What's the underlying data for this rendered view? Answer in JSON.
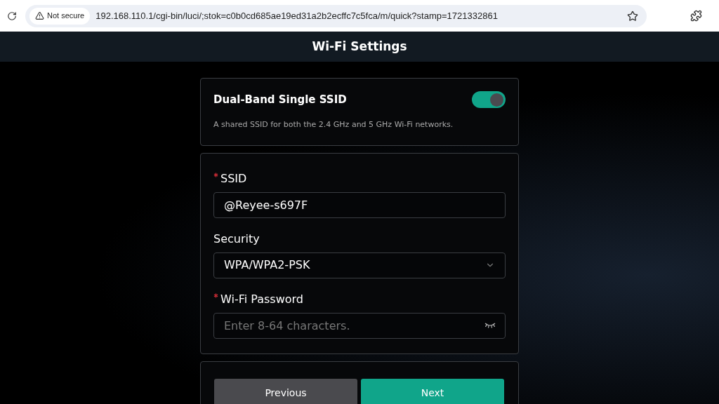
{
  "browser": {
    "security_label": "Not secure",
    "url": "192.168.110.1/cgi-bin/luci/;stok=c0b0cd685ae19ed31a2b2ecffc7c5fca/m/quick?stamp=1721332861"
  },
  "header": {
    "title": "Wi-Fi Settings"
  },
  "dual_band": {
    "title": "Dual-Band Single SSID",
    "description": "A shared SSID for both the 2.4 GHz and 5 GHz Wi-Fi networks.",
    "on": true
  },
  "form": {
    "fields": [
      {
        "kind": "text",
        "label": "SSID",
        "required": true,
        "value": "@Reyee-s697F"
      },
      {
        "kind": "select",
        "label": "Security",
        "required": false,
        "value": "WPA/WPA2-PSK"
      },
      {
        "kind": "password",
        "label": "Wi-Fi Password",
        "required": true,
        "placeholder": "Enter 8-64 characters."
      }
    ]
  },
  "buttons": [
    {
      "label": "Previous",
      "kind": "secondary"
    },
    {
      "label": "Next",
      "kind": "primary"
    }
  ]
}
